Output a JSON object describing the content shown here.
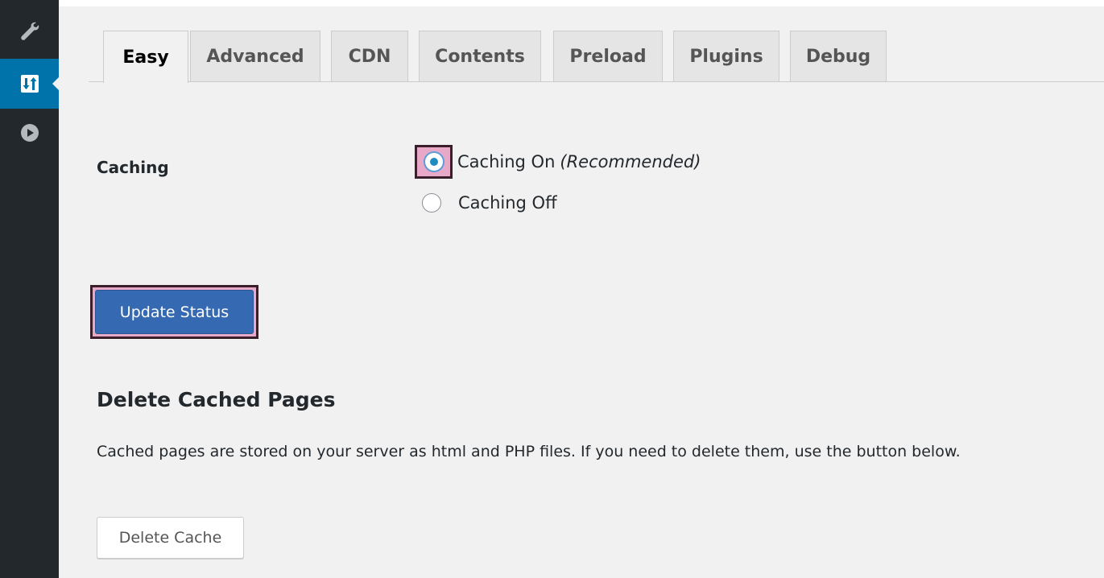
{
  "sidebar": {
    "items": [
      {
        "icon": "wrench-icon",
        "active": false
      },
      {
        "icon": "settings-sliders-icon",
        "active": true
      },
      {
        "icon": "play-icon",
        "active": false
      }
    ],
    "colors": {
      "background": "#23282d",
      "active": "#0073aa"
    }
  },
  "tabs": [
    {
      "label": "Easy",
      "active": true
    },
    {
      "label": "Advanced",
      "active": false
    },
    {
      "label": "CDN",
      "active": false
    },
    {
      "label": "Contents",
      "active": false
    },
    {
      "label": "Preload",
      "active": false
    },
    {
      "label": "Plugins",
      "active": false
    },
    {
      "label": "Debug",
      "active": false
    }
  ],
  "caching": {
    "label": "Caching",
    "options": {
      "on": {
        "label": "Caching On",
        "note": "(Recommended)",
        "checked": true
      },
      "off": {
        "label": "Caching Off",
        "checked": false
      }
    }
  },
  "update_button": {
    "label": "Update Status",
    "color": "#3569b2"
  },
  "delete_section": {
    "heading": "Delete Cached Pages",
    "description": "Cached pages are stored on your server as html and PHP files. If you need to delete them, use the button below.",
    "button_label": "Delete Cache"
  }
}
